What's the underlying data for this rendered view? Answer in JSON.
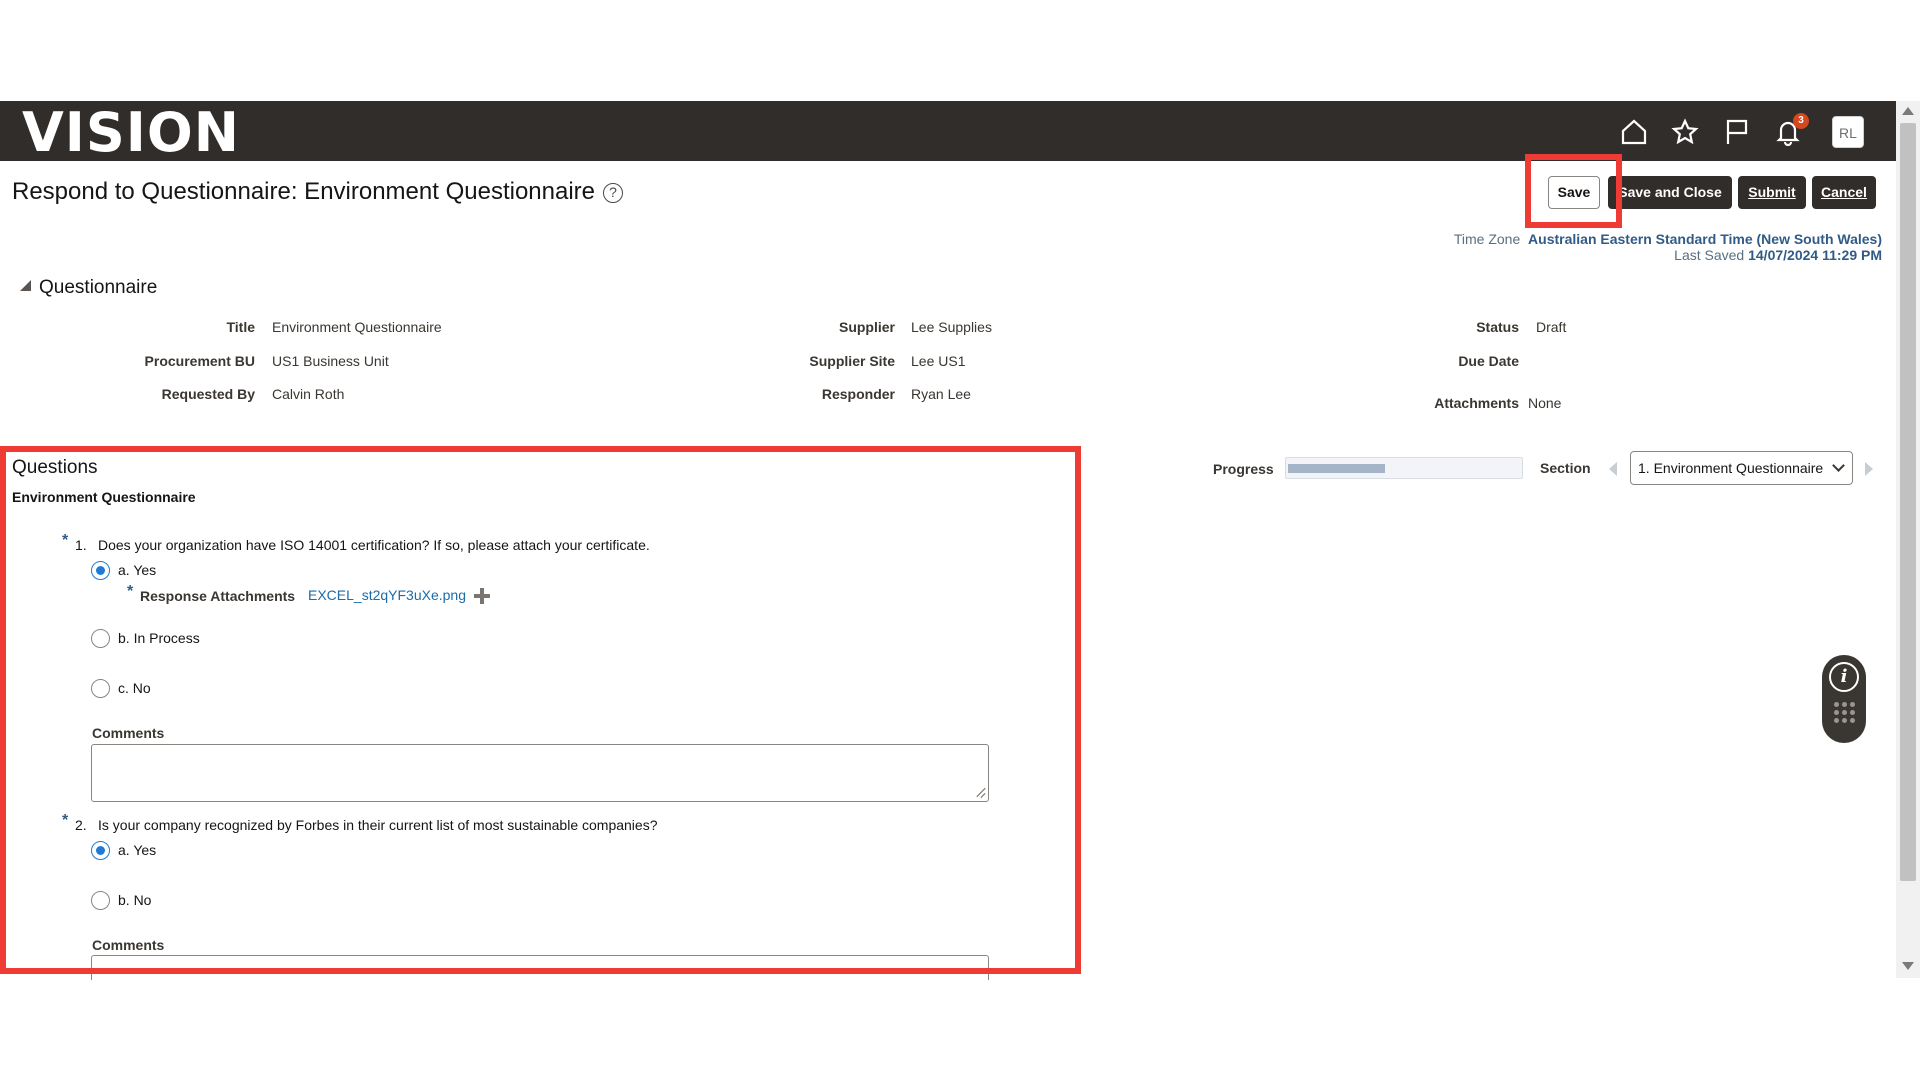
{
  "app": {
    "logo": "VISION",
    "avatar_initials": "RL",
    "notification_count": "3"
  },
  "header_icons": [
    "home-icon",
    "star-icon",
    "flag-icon",
    "bell-icon"
  ],
  "page": {
    "title": "Respond to Questionnaire: Environment Questionnaire",
    "help_glyph": "?"
  },
  "actions": {
    "save": "Save",
    "save_and_close": "Save and Close",
    "submit": "Submit",
    "cancel": "Cancel"
  },
  "meta": {
    "time_zone_label": "Time Zone",
    "time_zone_value": "Australian Eastern Standard Time (New South Wales)",
    "last_saved_label": "Last Saved",
    "last_saved_value": "14/07/2024 11:29 PM"
  },
  "questionnaire": {
    "heading": "Questionnaire",
    "title_label": "Title",
    "title_value": "Environment Questionnaire",
    "bu_label": "Procurement BU",
    "bu_value": "US1 Business Unit",
    "requested_by_label": "Requested By",
    "requested_by_value": "Calvin Roth",
    "supplier_label": "Supplier",
    "supplier_value": "Lee Supplies",
    "supplier_site_label": "Supplier Site",
    "supplier_site_value": "Lee US1",
    "responder_label": "Responder",
    "responder_value": "Ryan Lee",
    "status_label": "Status",
    "status_value": "Draft",
    "due_date_label": "Due Date",
    "due_date_value": "",
    "attachments_label": "Attachments",
    "attachments_value": "None"
  },
  "questions": {
    "heading": "Questions",
    "section_name": "Environment Questionnaire",
    "progress_label": "Progress",
    "progress_fraction": 0.42,
    "section_label": "Section",
    "section_selected": "1. Environment Questionnaire",
    "required_mark": "*",
    "items": [
      {
        "number": "1.",
        "text": "Does your organization have ISO 14001 certification?  If so, please attach your certificate.",
        "options": [
          {
            "label": "a. Yes",
            "selected": true
          },
          {
            "label": "b. In Process",
            "selected": false
          },
          {
            "label": "c. No",
            "selected": false
          }
        ],
        "attachment_label": "Response Attachments",
        "attachment_file": "EXCEL_st2qYF3uXe.png",
        "comments_label": "Comments"
      },
      {
        "number": "2.",
        "text": "Is your company recognized by Forbes in their current list of most sustainable companies?",
        "options": [
          {
            "label": "a. Yes",
            "selected": true
          },
          {
            "label": "b. No",
            "selected": false
          }
        ],
        "comments_label": "Comments"
      }
    ]
  },
  "colors": {
    "header_bg": "#312d2a",
    "highlight": "#ee3b33",
    "radio_selected": "#227ad3",
    "link": "#1b6ca8"
  }
}
